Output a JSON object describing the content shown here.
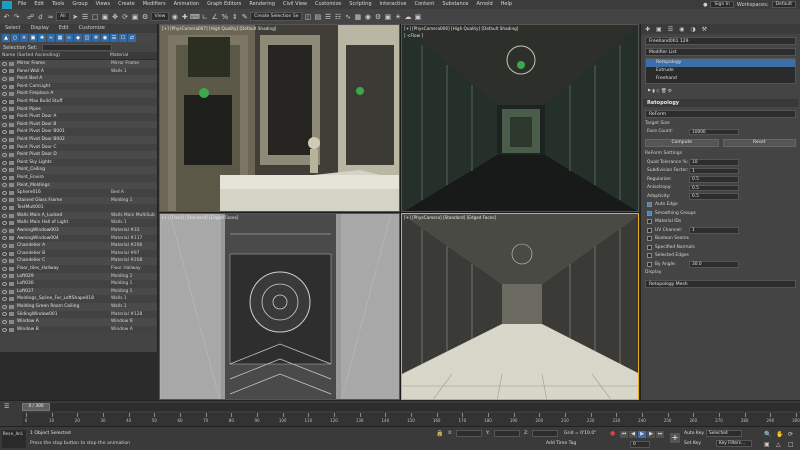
{
  "menubar": {
    "items": [
      "File",
      "Edit",
      "Tools",
      "Group",
      "Views",
      "Create",
      "Modifiers",
      "Animation",
      "Graph Editors",
      "Rendering",
      "Civil View",
      "Customize",
      "Scripting",
      "Interactive",
      "Content",
      "Substance",
      "Arnold",
      "Help"
    ],
    "sign_in": "Sign In",
    "workspaces_label": "Workspaces:",
    "workspaces_value": "Default"
  },
  "toolbar": {
    "filter_select": "All",
    "view_select": "View",
    "selection_set": "Create Selection Se"
  },
  "scene_explorer": {
    "menu": [
      "Select",
      "Display",
      "Edit",
      "Customize"
    ],
    "selection_set_label": "Selection Set:",
    "col_name": "Name (Sorted Ascending)",
    "col_material": "Material",
    "rows": [
      {
        "name": "Mirror Frame",
        "mat": "Mirror Frame"
      },
      {
        "name": "Panel Wall A",
        "mat": "Walls 1"
      },
      {
        "name": "Point Bed A",
        "mat": ""
      },
      {
        "name": "Point CamLight",
        "mat": ""
      },
      {
        "name": "Point Fireplace A",
        "mat": ""
      },
      {
        "name": "Point Max Build Stuff",
        "mat": ""
      },
      {
        "name": "Point Pipes",
        "mat": ""
      },
      {
        "name": "Point Pivot Door A",
        "mat": ""
      },
      {
        "name": "Point Pivot Door B",
        "mat": ""
      },
      {
        "name": "Point Pivot Door B001",
        "mat": ""
      },
      {
        "name": "Point Pivot Door B002",
        "mat": ""
      },
      {
        "name": "Point Pivot Door C",
        "mat": ""
      },
      {
        "name": "Point Pivot Door D",
        "mat": ""
      },
      {
        "name": "Point Sky Lights",
        "mat": ""
      },
      {
        "name": "Point_Ceiling",
        "mat": ""
      },
      {
        "name": "Point_Enviro",
        "mat": ""
      },
      {
        "name": "Point_Moldings",
        "mat": ""
      },
      {
        "name": "Sphere016",
        "mat": "Bed A"
      },
      {
        "name": "Stained Glass Frame",
        "mat": "Molding 1"
      },
      {
        "name": "TestMult001",
        "mat": ""
      },
      {
        "name": "Walls Main A_Locked",
        "mat": "Walls Main MultiSub"
      },
      {
        "name": "Walls Main Hall of Light",
        "mat": "Walls 1"
      },
      {
        "name": "AwningWindow003",
        "mat": "Material #33"
      },
      {
        "name": "AwningWindow004",
        "mat": "Material #117"
      },
      {
        "name": "Chandelier A",
        "mat": "Material #206"
      },
      {
        "name": "Chandelier B",
        "mat": "Material #97"
      },
      {
        "name": "Chandelier C",
        "mat": "Material #208"
      },
      {
        "name": "Floor_tiles_Hallway",
        "mat": "Floor Hallway"
      },
      {
        "name": "Loft029",
        "mat": "Molding 1"
      },
      {
        "name": "Loft030",
        "mat": "Molding 1"
      },
      {
        "name": "Loft037",
        "mat": "Molding 1"
      },
      {
        "name": "Moldings_Spline_For_LoftShape018",
        "mat": "Walls 1"
      },
      {
        "name": "Molding Green Room Ceiling",
        "mat": "Walls 1"
      },
      {
        "name": "SlidingWindow001",
        "mat": "Material #128"
      },
      {
        "name": "Window A",
        "mat": "Window B"
      },
      {
        "name": "Window B",
        "mat": "Window A"
      }
    ]
  },
  "viewports": {
    "top_left_label": "[+] [PhysCamera007] [High Quality] [Default Shading]",
    "top_right_label": "[+] [PhysCamera006] [High Quality] [Default Shading]",
    "top_right_sub": "[ <Flow ]",
    "bottom_left_label": "[+] [Front] [Standard] [Edged Faces]",
    "bottom_right_label": "[+] [PhysCamera] [Standard] [Edged Faces]"
  },
  "command_panel": {
    "object_name": "Freehand001 129",
    "modifier_list": "Modifier List",
    "stack": [
      "Retopology",
      "Extrude",
      "Freehand"
    ],
    "rollout_title": "Retopology",
    "reform_label": "ReForm",
    "target_size": "Target Size",
    "face_count_label": "Face Count:",
    "face_count": "10000",
    "compute_btn": "Compute",
    "reset_btn": "Reset",
    "reform_settings": "ReForm Settings",
    "quad_tol_label": "Quad Tolerance %:",
    "quad_tol": "10",
    "subdiv_label": "Subdivision Factor:",
    "subdiv": "1",
    "regularize_label": "Regularize:",
    "regularize": "0.5",
    "anisotropy_label": "Anisotropy:",
    "anisotropy": "0.5",
    "adaptivity_label": "Adaptivity:",
    "adaptivity": "0.5",
    "auto_edge": "Auto Edge",
    "smoothing_groups": "Smoothing Groups",
    "material_ids": "Material IDs",
    "uv_channel_label": "UV Channel:",
    "uv_channel": "1",
    "boolean_seams": "Boolean Seams",
    "specified_normals": "Specified Normals",
    "selected_edges": "Selected Edges",
    "by_angle_label": "By Angle:",
    "by_angle": "30.0",
    "display_label": "Display",
    "display_value": "Retopology Mesh"
  },
  "timeline": {
    "frame_display": "0 / 300",
    "ticks": [
      0,
      10,
      20,
      30,
      40,
      50,
      60,
      70,
      80,
      90,
      100,
      110,
      120,
      130,
      140,
      150,
      160,
      170,
      180,
      190,
      200,
      210,
      220,
      230,
      240,
      250,
      260,
      270,
      280,
      290,
      300
    ]
  },
  "status": {
    "maxscript": "Rese_Ani",
    "selected": "1 Object Selected",
    "prompt": "Press the stop button to stop the animation",
    "x_label": "X:",
    "y_label": "Y:",
    "z_label": "Z:",
    "grid": "Grid = 0'10.0\"",
    "add_time_tag": "Add Time Tag",
    "auto_key": "Auto Key",
    "selected_dropdown": "Selected",
    "set_key": "Set Key",
    "key_filters": "Key Filters...",
    "frame_value": "0"
  }
}
